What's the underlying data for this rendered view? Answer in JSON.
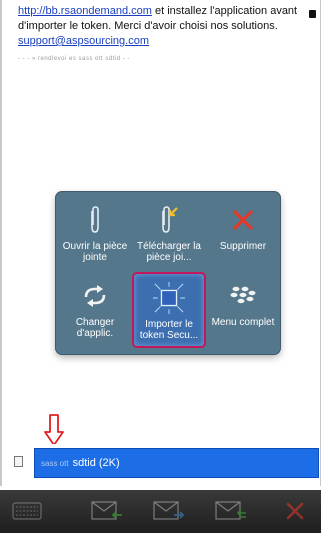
{
  "email": {
    "link_text": "http://bb.rsaondemand.com",
    "line1_rest": " et installez l'application avant",
    "line2": "d'importer le token. Merci d'avoir choisi nos solutions.",
    "support_email": "support@aspsourcing.com",
    "faint_line": "- - - »  rendlevoi  es  sass  ott  sdtid  - -"
  },
  "menu": {
    "items": [
      {
        "label": "Ouvrir la pièce jointe",
        "icon": "paperclip-icon"
      },
      {
        "label": "Télécharger la pièce joi...",
        "icon": "download-attachment-icon"
      },
      {
        "label": "Supprimer",
        "icon": "delete-x-icon"
      },
      {
        "label": "Changer d'applic.",
        "icon": "switch-app-icon"
      },
      {
        "label": "Importer le token Secu...",
        "icon": "import-token-icon",
        "selected": true
      },
      {
        "label": "Menu complet",
        "icon": "blackberry-logo-icon"
      }
    ]
  },
  "attachment": {
    "prefix": "sass ott",
    "name": "sdtid (2K)"
  },
  "toolbar": {
    "icons": [
      "keyboard-icon",
      "reply-icon",
      "forward-icon",
      "reply-all-icon",
      "delete-icon"
    ]
  },
  "colors": {
    "popup_bg": "#55778b",
    "selection_border": "#c2185b",
    "attachment_highlight": "#1d6ee6",
    "annotation_arrow": "#e02020",
    "delete_red": "#e23a2a"
  }
}
